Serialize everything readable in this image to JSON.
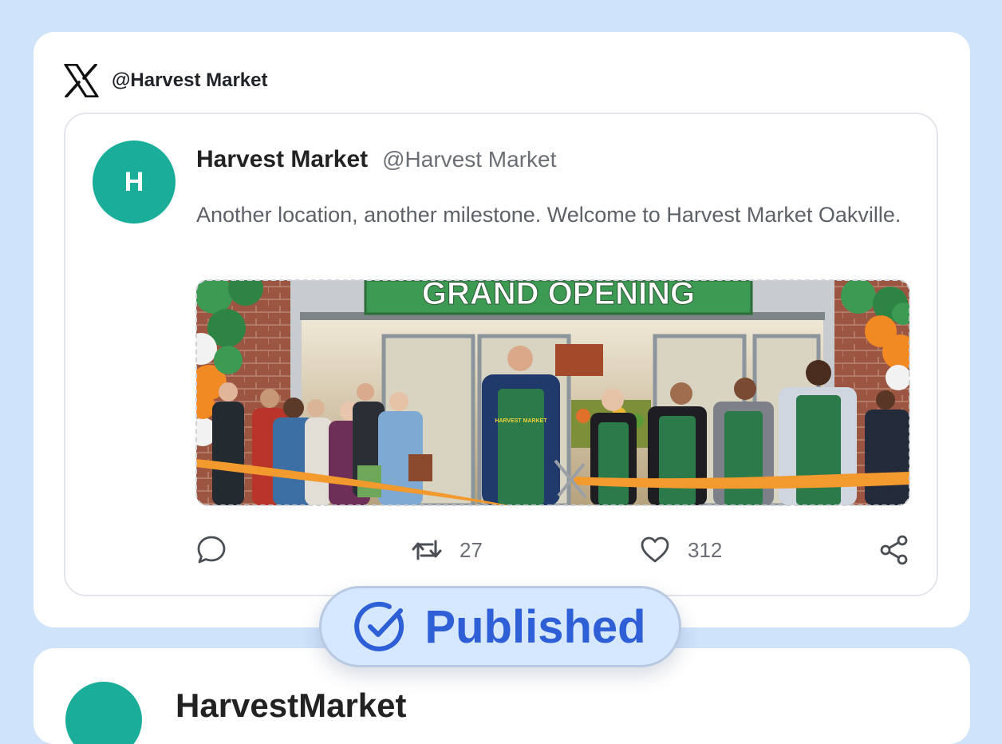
{
  "account": {
    "handle": "@Harvest Market",
    "platform_icon": "x-logo-icon"
  },
  "post": {
    "avatar_initial": "H",
    "display_name": "Harvest Market",
    "handle": "@Harvest Market",
    "text": "Another location, another milestone. Welcome to Harvest Market Oakville.",
    "image": {
      "description_icon": "grand-opening-photo",
      "sign_text": "GRAND OPENING",
      "apron_text": "HARVEST MARKET"
    },
    "actions": {
      "reply_icon": "comment-icon",
      "repost_icon": "repost-icon",
      "repost_count": "27",
      "like_icon": "heart-icon",
      "like_count": "312",
      "share_icon": "share-icon"
    }
  },
  "status_badge": {
    "label": "Published",
    "icon": "check-circle-icon",
    "color": "#2f5fd6"
  },
  "next_post": {
    "display_name": "HarvestMarket"
  },
  "colors": {
    "background": "#cfe3fb",
    "avatar": "#1aae9a",
    "sign_green": "#3d9a52",
    "ribbon": "#f29a2e"
  }
}
